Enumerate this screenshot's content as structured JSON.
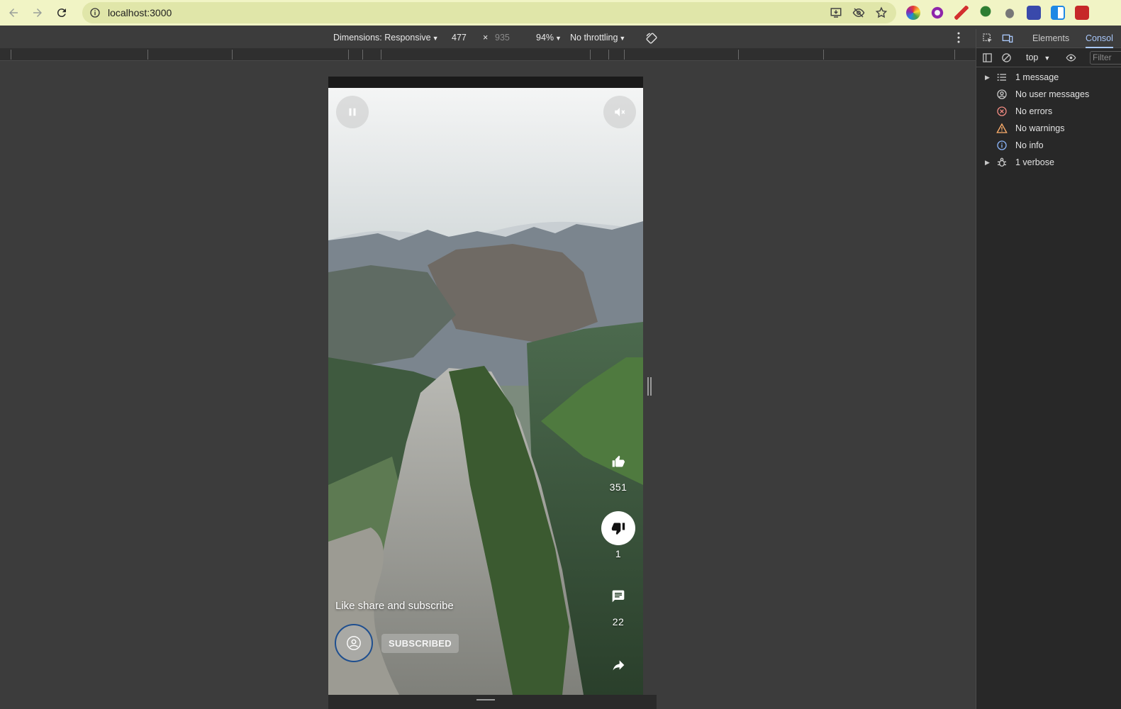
{
  "browser": {
    "url": "localhost:3000"
  },
  "device_toolbar": {
    "dimensions_label": "Dimensions: Responsive",
    "width": "477",
    "times": "×",
    "height": "935",
    "zoom": "94%",
    "throttling": "No throttling"
  },
  "video": {
    "caption": "Like share and subscribe",
    "subscribe_label": "SUBSCRIBED",
    "likes": "351",
    "dislikes": "1",
    "comments": "22"
  },
  "devtools": {
    "tabs": [
      "Elements",
      "Consol"
    ],
    "context": "top",
    "filter_placeholder": "Filter",
    "sidebar": [
      {
        "label": "1 message"
      },
      {
        "label": "No user messages"
      },
      {
        "label": "No errors"
      },
      {
        "label": "No warnings"
      },
      {
        "label": "No info"
      },
      {
        "label": "1 verbose"
      }
    ]
  },
  "colors": {
    "omnibox_bg": "#f1f4c5",
    "accent_blue": "#a8c7fa",
    "error_red": "#f28b82",
    "warning_orange": "#fdae6b",
    "info_blue": "#8ab4f8"
  }
}
